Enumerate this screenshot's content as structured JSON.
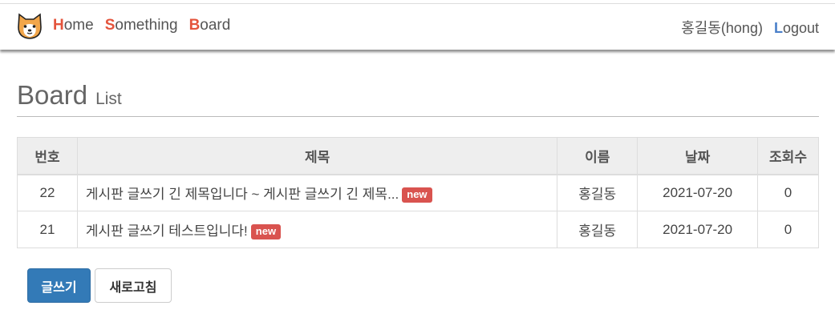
{
  "nav": {
    "items": [
      {
        "first": "H",
        "rest": "ome"
      },
      {
        "first": "S",
        "rest": "omething"
      },
      {
        "first": "B",
        "rest": "oard"
      }
    ],
    "user": "홍길동(hong)",
    "logout": {
      "first": "L",
      "rest": "ogout"
    }
  },
  "page": {
    "title": "Board",
    "subtitle": "List"
  },
  "table": {
    "headers": [
      "번호",
      "제목",
      "이름",
      "날짜",
      "조회수"
    ],
    "rows": [
      {
        "no": "22",
        "subject": "게시판 글쓰기 긴 제목입니다 ~ 게시판 글쓰기 긴 제목...",
        "badge": "new",
        "name": "홍길동",
        "date": "2021-07-20",
        "views": "0"
      },
      {
        "no": "21",
        "subject": "게시판 글쓰기 테스트입니다!",
        "badge": "new",
        "name": "홍길동",
        "date": "2021-07-20",
        "views": "0"
      }
    ]
  },
  "buttons": {
    "write": "글쓰기",
    "refresh": "새로고침"
  },
  "colors": {
    "accent_red": "#e4543c",
    "accent_blue": "#4a7fc9",
    "badge": "#d9534f",
    "primary": "#337ab7"
  },
  "icons": {
    "logo": "dog-face-icon"
  }
}
